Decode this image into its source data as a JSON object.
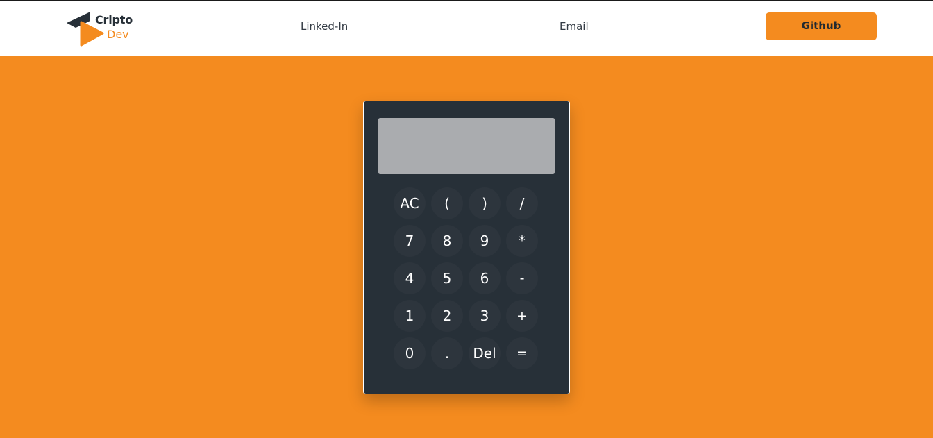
{
  "header": {
    "logo": {
      "word1": "Cripto",
      "word2": "Dev",
      "icon": "play-triangle-logo-icon"
    },
    "links": {
      "linkedin": "Linked-In",
      "email": "Email"
    },
    "github_label": "Github"
  },
  "calculator": {
    "display_value": "",
    "keys": {
      "ac": "AC",
      "lparen": "(",
      "rparen": ")",
      "divide": "/",
      "k7": "7",
      "k8": "8",
      "k9": "9",
      "multiply": "*",
      "k4": "4",
      "k5": "5",
      "k6": "6",
      "minus": "-",
      "k1": "1",
      "k2": "2",
      "k3": "3",
      "plus": "+",
      "k0": "0",
      "dot": ".",
      "del": "Del",
      "equals": "="
    }
  },
  "colors": {
    "accent": "#f48b1f",
    "dark": "#273038",
    "display": "#aaacaf",
    "navbar": "#ffffff"
  }
}
